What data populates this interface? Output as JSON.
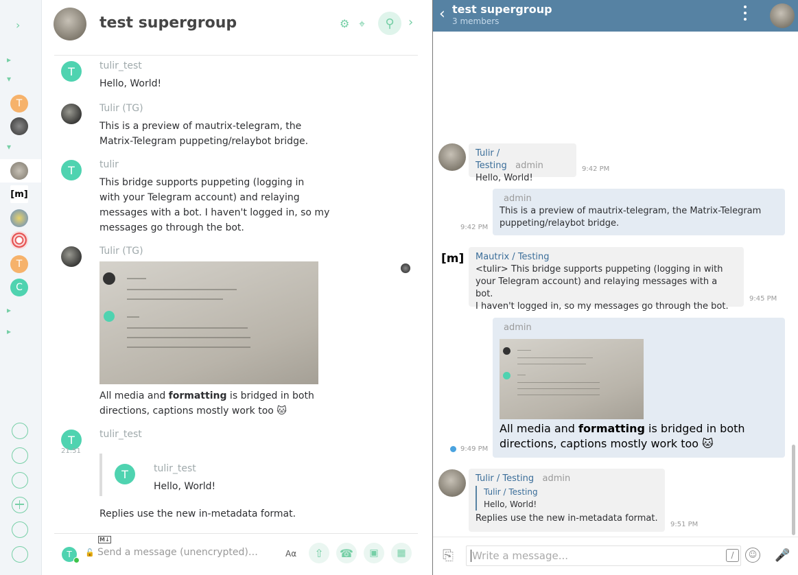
{
  "riot": {
    "room_title": "test supergroup",
    "messages": [
      {
        "sender": "tulir_test",
        "text": "Hello, World!"
      },
      {
        "sender": "Tulir (TG)",
        "text_l1": "This is a preview of mautrix-telegram, the",
        "text_l2": "Matrix-Telegram puppeting/relaybot bridge."
      },
      {
        "sender": "tulir",
        "text_l1": "This bridge supports puppeting (logging in",
        "text_l2": "with your Telegram account) and relaying",
        "text_l3": "messages with a bot. I haven't logged in, so my",
        "text_l4": "messages go through the bot."
      },
      {
        "sender": "Tulir (TG)",
        "cap_pre": "All media and ",
        "cap_bold": "formatting",
        "cap_post": " is bridged in both",
        "cap_l2": "directions, captions mostly work too 🐱"
      },
      {
        "sender": "tulir_test",
        "time": "21:51",
        "quote_sender": "tulir_test",
        "quote_text": "Hello, World!",
        "text": "Replies use the new in-metadata format."
      }
    ],
    "composer": {
      "placeholder": "Send a message (unencrypted)…",
      "md_badge": "M↓",
      "format_label": "Aα"
    },
    "avatar_letter": "T"
  },
  "telegram": {
    "title": "test supergroup",
    "subtitle": "3 members",
    "messages": [
      {
        "sender": "Tulir / Testing",
        "badge": "admin",
        "text": "Hello, World!",
        "time": "9:42 PM"
      },
      {
        "badge": "admin",
        "text_l1": "This is a preview of mautrix-telegram, the Matrix-Telegram",
        "text_l2": "puppeting/relaybot bridge.",
        "time": "9:42 PM"
      },
      {
        "sender": "Mautrix / Testing",
        "text_l1": "<tulir> This bridge supports puppeting (logging in with",
        "text_l2": "your Telegram account) and relaying messages with a bot.",
        "text_l3": "I haven't logged in, so my messages go through the bot.",
        "time": "9:45 PM",
        "avatar": "[m]"
      },
      {
        "badge": "admin",
        "cap_pre": "All media and ",
        "cap_bold": "formatting",
        "cap_post": " is bridged in both",
        "cap_l2": "directions, captions mostly work too 🐱",
        "time": "9:49 PM"
      },
      {
        "sender": "Tulir / Testing",
        "badge": "admin",
        "reply_sender": "Tulir / Testing",
        "reply_text": "Hello, World!",
        "text": "Replies use the new in-metadata format.",
        "time": "9:51 PM"
      }
    ],
    "composer": {
      "placeholder": "Write a message..."
    }
  },
  "strip": {
    "letters": [
      "T",
      "T",
      "C"
    ],
    "matrix_icon": "[m]"
  },
  "colors": {
    "accent": "#76cfa6",
    "telegram_header": "#5682a3",
    "avatar_green": "#4fd3b0",
    "avatar_orange": "#f6b26b"
  }
}
